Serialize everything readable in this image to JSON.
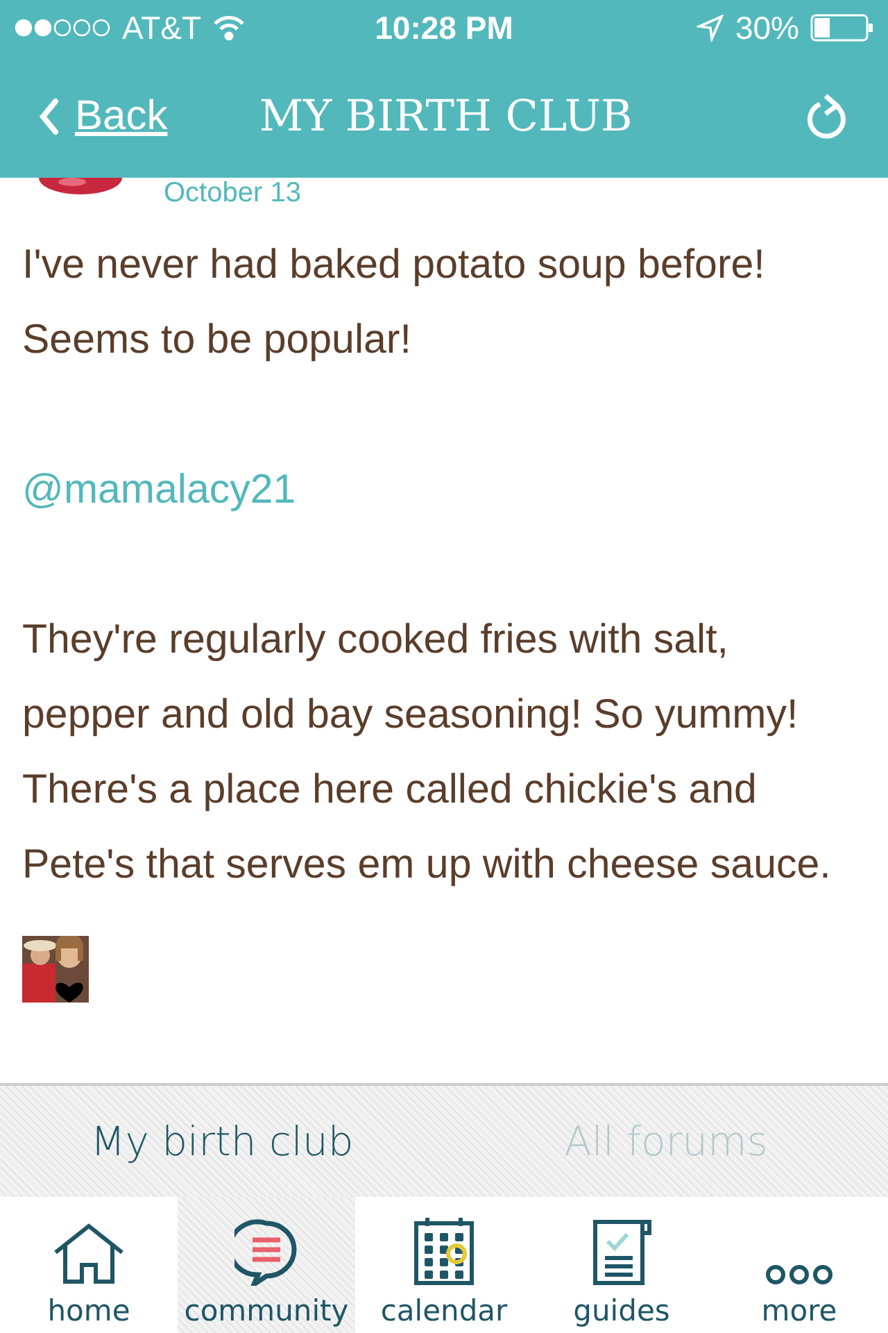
{
  "status_bar": {
    "carrier": "AT&T",
    "time": "10:28 PM",
    "battery": "30%"
  },
  "nav": {
    "back": "Back",
    "title": "MY BIRTH CLUB"
  },
  "post": {
    "date": "October 13",
    "paragraphs": [
      {
        "kind": "text",
        "text": "I've never had baked potato soup before! Seems to be popular!"
      },
      {
        "kind": "mention",
        "text": "@mamalacy21"
      },
      {
        "kind": "text",
        "text": "They're regularly cooked fries with salt, pepper and old bay seasoning! So yummy! There's a place here called chickie's and Pete's that serves em up with cheese sauce."
      }
    ]
  },
  "segments": [
    {
      "label": "My birth club",
      "selected": true
    },
    {
      "label": "All forums",
      "selected": false
    }
  ],
  "tabs": [
    {
      "label": "home",
      "kind": "home",
      "selected": false
    },
    {
      "label": "community",
      "kind": "chat",
      "selected": true
    },
    {
      "label": "calendar",
      "kind": "calendar",
      "selected": false
    },
    {
      "label": "guides",
      "kind": "guide",
      "selected": false
    },
    {
      "label": "more",
      "kind": "more",
      "selected": false
    }
  ]
}
